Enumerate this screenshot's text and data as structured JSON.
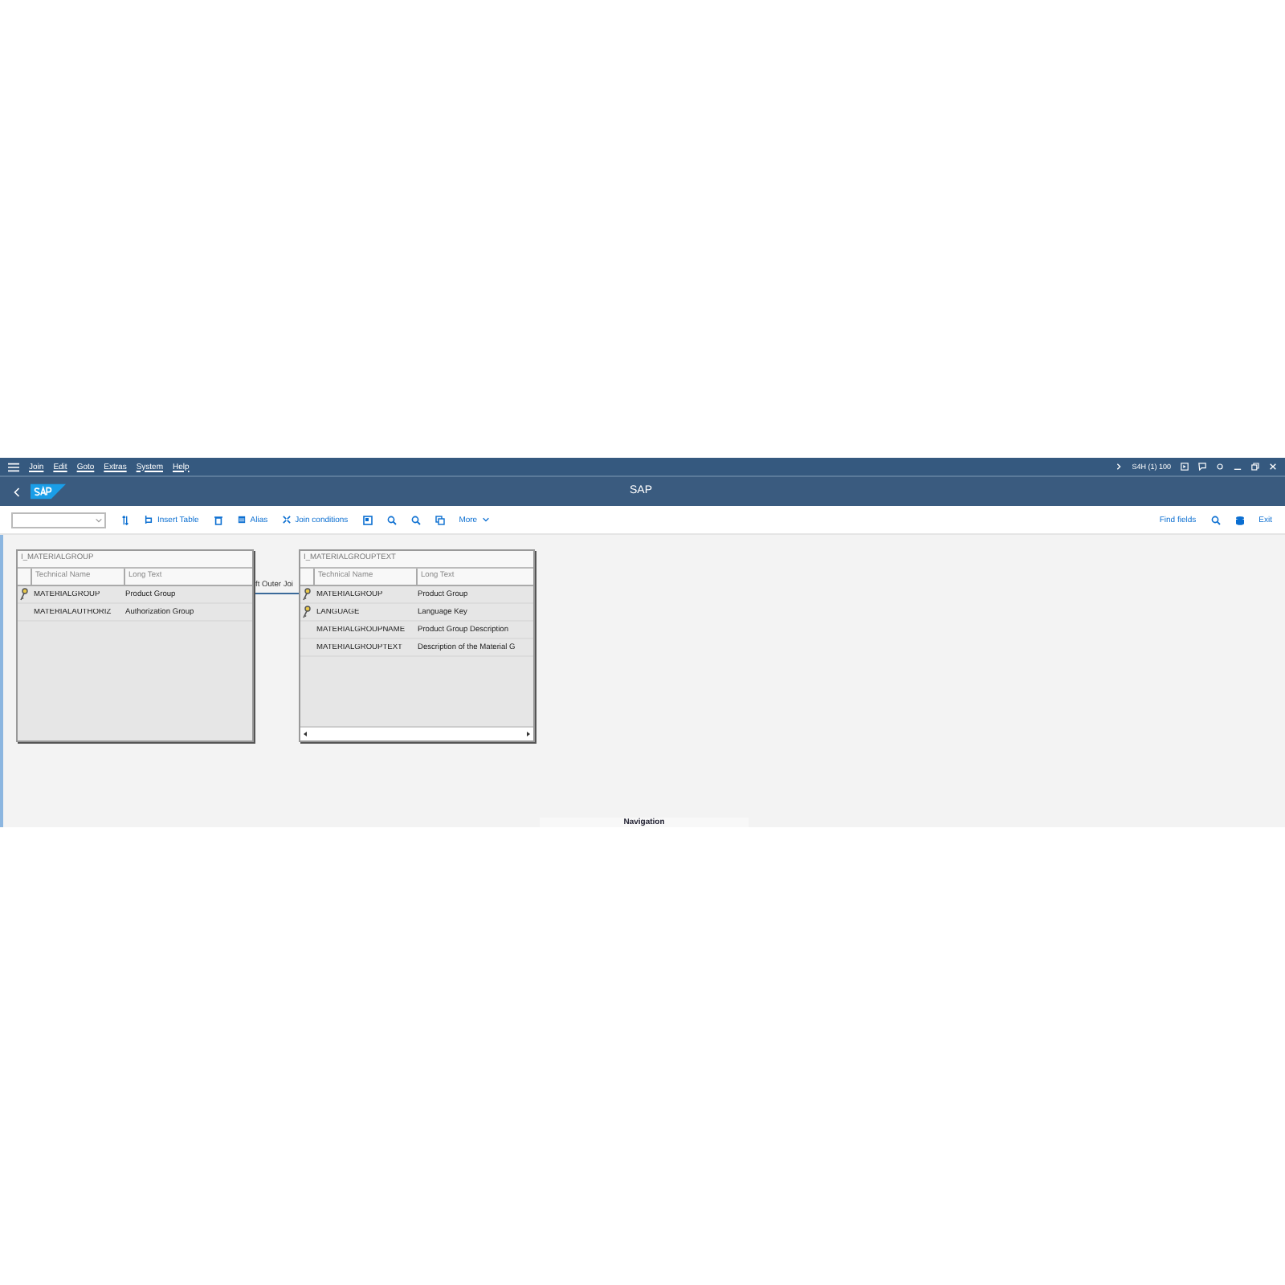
{
  "menu": [
    "Join",
    "Edit",
    "Goto",
    "Extras",
    "System",
    "Help"
  ],
  "system_info": "S4H (1) 100",
  "title": "SAP",
  "toolbar": {
    "insert_table": "Insert Table",
    "alias": "Alias",
    "join_conditions": "Join conditions",
    "more": "More",
    "find_fields": "Find fields",
    "exit": "Exit"
  },
  "tables": [
    {
      "name": "I_MATERIALGROUP",
      "columns": [
        "Technical Name",
        "Long Text"
      ],
      "horizontal_scrollbar": false,
      "rows": [
        {
          "technical_name": "MATERIALGROUP",
          "long_text": "Product Group",
          "key": true
        },
        {
          "technical_name": "MATERIALAUTHORIZ",
          "long_text": "Authorization Group",
          "key": false
        }
      ]
    },
    {
      "name": "I_MATERIALGROUPTEXT",
      "columns": [
        "Technical Name",
        "Long Text"
      ],
      "horizontal_scrollbar": true,
      "rows": [
        {
          "technical_name": "MATERIALGROUP",
          "long_text": "Product Group",
          "key": true
        },
        {
          "technical_name": "LANGUAGE",
          "long_text": "Language Key",
          "key": true
        },
        {
          "technical_name": "MATERIALGROUPNAME",
          "long_text": "Product Group Description",
          "key": false
        },
        {
          "technical_name": "MATERIALGROUPTEXT",
          "long_text": "Description of the Material G",
          "key": false
        }
      ]
    }
  ],
  "join": {
    "label": "ft Outer Joi"
  },
  "navigation": {
    "title": "Navigation"
  }
}
